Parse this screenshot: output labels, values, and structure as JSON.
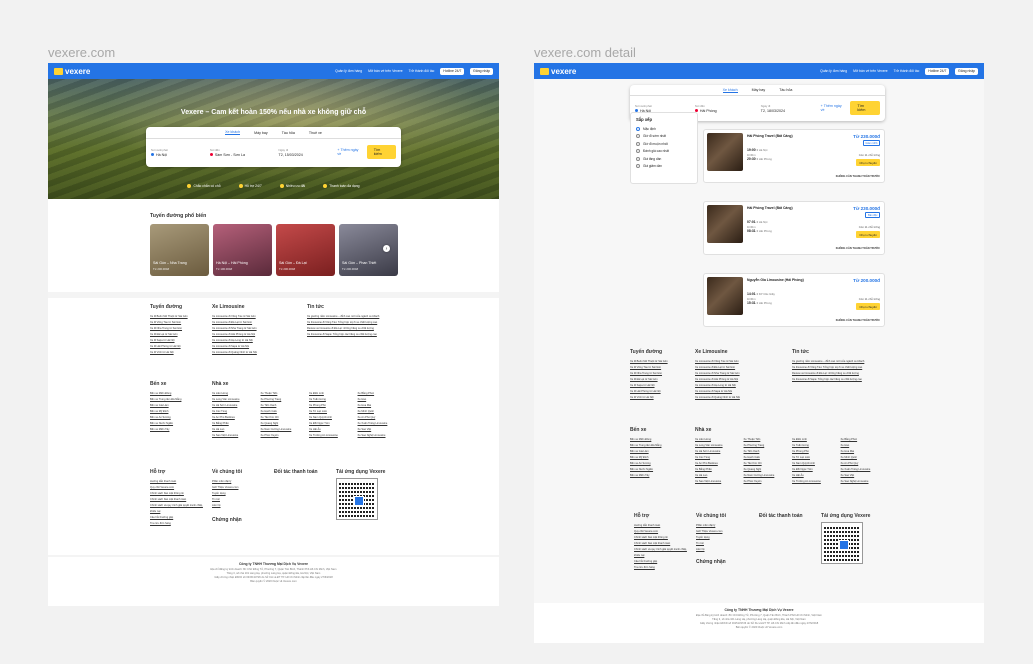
{
  "boards": {
    "left": "vexere.com",
    "right": "vexere.com detail"
  },
  "nav": {
    "logo": "vexere",
    "links": [
      "Quản lý đơn hàng",
      "Mở bán vé trên Vexere",
      "Trở thành đối tác"
    ],
    "hotline": "Hotline 24/7",
    "login": "Đăng nhập"
  },
  "hero": {
    "title": "Vexere – Cam kết hoàn 150% nếu nhà xe không giữ chỗ"
  },
  "search": {
    "tabs": [
      "Xe khách",
      "Máy bay",
      "Tàu hỏa",
      "Thuê xe"
    ],
    "from_label": "Nơi xuất phát",
    "from": "Hà Nội",
    "to_label": "Nơi đến",
    "to": "Sầm Sơn - Sơn La",
    "date_label": "Ngày đi",
    "date": "T2, 15/03/2024",
    "add_return": "+ Thêm ngày về",
    "submit": "Tìm kiếm"
  },
  "features": [
    "Chắc chắn có chỗ",
    "Hỗ trợ 24/7",
    "Nhiều ưu đãi",
    "Thanh toán đa dạng"
  ],
  "routes": {
    "title": "Tuyến đường phổ biến",
    "items": [
      {
        "name": "Sài Gòn – Nha Trang",
        "price": "Từ 200.000đ",
        "color1": "#6b5b3e",
        "color2": "#a89a7a"
      },
      {
        "name": "Hà Nội – Hải Phòng",
        "price": "Từ 100.000đ",
        "color1": "#5a2a3a",
        "color2": "#b5607a"
      },
      {
        "name": "Sài Gòn – Đà Lạt",
        "price": "Từ 200.000đ",
        "color1": "#7a1f1f",
        "color2": "#c44a4a"
      },
      {
        "name": "Sài Gòn – Phan Thiết",
        "price": "Từ 200.000đ",
        "color1": "#3a3a46",
        "color2": "#8a8a9a"
      }
    ]
  },
  "footer": {
    "routes_h": "Tuyến đường",
    "routes": [
      "Xe đi Buôn Mê Thuột từ Sài Gòn",
      "Xe đi Vũng Tàu từ Sài Gòn",
      "Xe đi Nha Trang từ Sài Gòn",
      "Xe đi Đà Lạt từ Sài Gòn",
      "Xe đi Sapa từ Hà Nội",
      "Xe đi Hải Phòng từ Hà Nội",
      "Xe đi Vinh từ Hà Nội"
    ],
    "limo_h": "Xe Limousine",
    "limo": [
      "Xe Limousine đi Vũng Tàu từ Sài Gòn",
      "Xe Limousine đi Đà Lạt từ Sài Gòn",
      "Xe Limousine đi Nha Trang từ Sài Gòn",
      "Xe Limousine đi Hải Phòng từ Hà Nội",
      "Xe Limousine đi Hạ Long từ Hà Nội",
      "Xe Limousine đi Sapa từ Hà Nội",
      "Xe Limousine đi Quảng Ninh từ Hà Nội"
    ],
    "news_h": "Tin tức",
    "news": [
      "Xe giường nằm Limousine – đỉnh cao mới của ngành xe khách",
      "Xe limousine đi Vũng Tàu: Tổng hợp top 6 xe chất lượng cao",
      "Review xe limousine đi Đà Lạt: những hãng xe chất lượng",
      "Xe limousine đi Sapa: Tổng hợp các hãng xe chất lượng cao"
    ],
    "stations_h": "Bến xe",
    "stations": [
      "Bến xe Miền Đông",
      "Bến xe Trung tâm Đà Nẵng",
      "Bến xe Gia Lâm",
      "Bến xe Mỹ Đình",
      "Bến xe An Sương",
      "Bến xe Nước Ngầm",
      "Bến xe Miền Tây"
    ],
    "operators_h": "Nhà xe",
    "operators": [
      [
        "Xe Liên Hưng",
        "Xe Long Vân Limousine",
        "Xe Hà Sơn Limousine",
        "Xe Cúc Tùng",
        "Xe An Phú Buslines",
        "Xe Bằng Phấn",
        "Xe Hà Lan",
        "Xe Sao Việt Limousine"
      ],
      [
        "Xe Thuận Tiến",
        "Xe Phương Trang",
        "Xe Tiến Oanh",
        "Xe Hạnh Cafe",
        "Xe Tân Kim Chi",
        "Xe Quang Nghị",
        "Xe Nam Cường Limousine",
        "Xe Phúc Xuyên"
      ],
      [
        "Xe Điền Linh",
        "Xe Tuấn Hưng",
        "Xe Phong Phú",
        "Xe Tứ Lạn Lâm",
        "Xe Nam Quỳnh Anh",
        "Xe Đồi Ngọc Tơm",
        "Xe Hải Âu",
        "Xe Trường An Limousine"
      ],
      [
        "Xe Bằng Phúc",
        "Xe Hào",
        "Xe Hoa Mai",
        "Xe Minh Quốc",
        "Xe An Phú Quý",
        "Xe Xuân Tráng Limousine",
        "Xe Sao Việt",
        "Xe Sao Nghệ Limousine"
      ]
    ],
    "support_h": "Hỗ trợ",
    "support": [
      "Hướng dẫn thanh toán",
      "Quy chế Vexere.com",
      "Chính sách bảo mật thông tin",
      "Chính sách bảo mật thanh toán",
      "Chính sách và quy trình giải quyết tranh chấp, khiếu nại",
      "Câu hỏi thường gặp",
      "Tra cứu đơn hàng"
    ],
    "about_h": "Về chúng tôi",
    "about": [
      "Phần mềm đại lý",
      "Giới Thiệu Vexere.com",
      "Tuyển dụng",
      "Tin tức",
      "Liên hệ"
    ],
    "partners_h": "Đối tác thanh toán",
    "app_h": "Tải ứng dụng Vexere",
    "cert_h": "Chứng nhận",
    "company": "Công ty TNHH Thương Mại Dịch Vụ Vexere",
    "company_lines": [
      "Địa chỉ đăng ký kinh doanh: 8C Chữ Đồng Tử, Phường 7, Quận Tân Bình, Thành Phố Hồ Chí Minh, Việt Nam",
      "Tầng 3, số nhà 101 Láng Hạ, phường Láng Hạ, quận Đống Đa, Hà Nội, Việt Nam",
      "Giấy chứng nhận ĐKKD số 0315133726 do Sở KH và ĐT TP. Hồ Chí Minh cấp lần đầu ngày 27/6/2018",
      "Bản quyền © 2020 thuộc về Vexere.com"
    ]
  },
  "detail": {
    "tabs": [
      "Xe khách",
      "Máy bay",
      "Tàu hỏa"
    ],
    "from": "Hà Nội",
    "to": "Hải Phòng",
    "date": "T2, 18/03/2024",
    "add_return": "+ Thêm ngày về",
    "submit": "Tìm kiếm",
    "sort_h": "Sắp xếp",
    "sort": [
      "Mặc định",
      "Giờ đi sớm nhất",
      "Giờ đi muộn nhất",
      "Đánh giá cao nhất",
      "Giá tăng dần",
      "Giá giảm dần"
    ],
    "trips": [
      {
        "op": "Hải Phòng Travel (Bất Cảng)",
        "price": "Từ 230.000đ",
        "tag": "Giảm 10%",
        "dep": "19:00",
        "dep_place": "Hà Nội",
        "dur": "1h30m",
        "arr": "20:30",
        "arr_place": "Hải Phòng",
        "seats": "Còn 11 chỗ trống",
        "choose": "Chọn chuyến",
        "nopay": "KHÔNG CẦN THANH TOÁN TRƯỚC"
      },
      {
        "op": "Hải Phòng Travel (Bất Cảng)",
        "price": "Từ 230.000đ",
        "tag": "Bán độc",
        "dep": "07:01",
        "dep_place": "Hà Nội",
        "dur": "1h30m",
        "arr": "08:31",
        "arr_place": "Hải Phòng",
        "seats": "Còn 11 chỗ trống",
        "choose": "Chọn chuyến",
        "nopay": "KHÔNG CẦN THANH TOÁN TRƯỚC"
      },
      {
        "op": "Nguyễn Gia Limousine (Hải Phòng)",
        "price": "Từ 200.000đ",
        "tag": "",
        "dep": "14:01",
        "dep_place": "KP Cầu Giấy",
        "dur": "1h30m",
        "arr": "15:31",
        "arr_place": "Hải Phòng",
        "seats": "Còn 11 chỗ trống",
        "choose": "Chọn chuyến",
        "nopay": "KHÔNG CẦN THANH TOÁN TRƯỚC"
      }
    ]
  },
  "colors": {
    "brand": "#2474e5",
    "accent": "#ffd333"
  }
}
